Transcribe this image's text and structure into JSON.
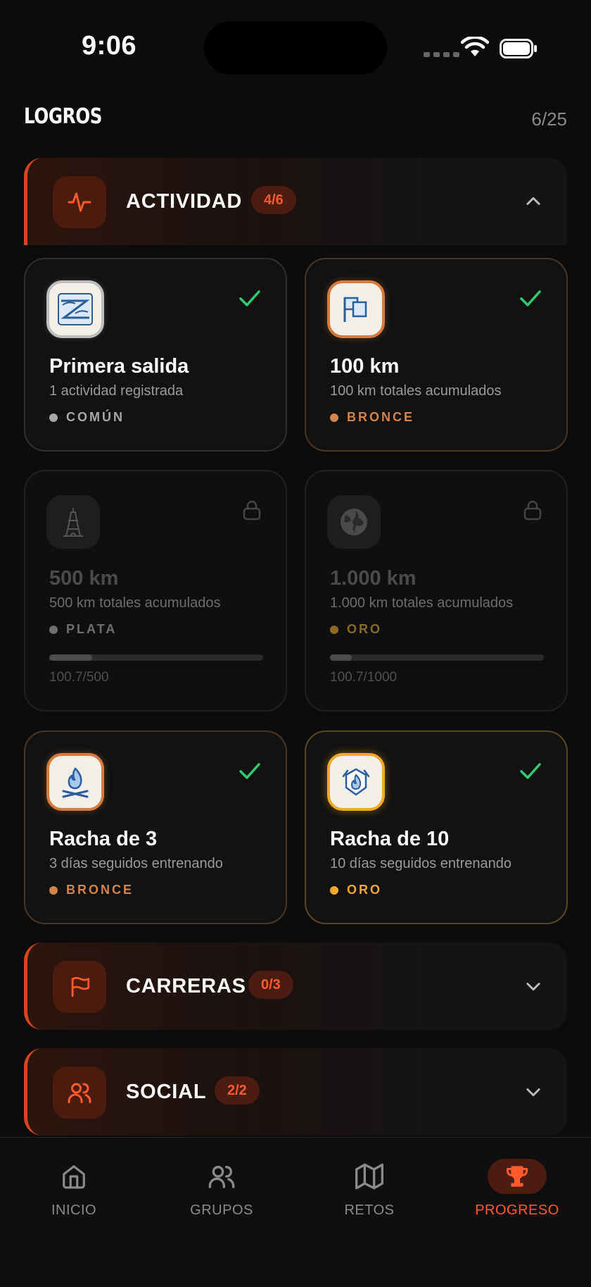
{
  "status_bar": {
    "time": "9:06"
  },
  "header": {
    "title": "LOGROS",
    "count": "6/25"
  },
  "sections": {
    "actividad": {
      "label": "ACTIVIDAD",
      "badge": "4/6",
      "expanded": true
    },
    "carreras": {
      "label": "CARRERAS",
      "badge": "0/3",
      "expanded": false
    },
    "social": {
      "label": "SOCIAL",
      "badge": "2/2",
      "expanded": false
    }
  },
  "achievements": [
    {
      "title": "Primera salida",
      "desc": "1 actividad registrada",
      "tier": "COMÚN",
      "tier_color": "#a8a8a8",
      "unlocked": true,
      "icon": "shoe-icon"
    },
    {
      "title": "100 km",
      "desc": "100 km totales acumulados",
      "tier": "BRONCE",
      "tier_color": "#d4834a",
      "unlocked": true,
      "icon": "flag-icon"
    },
    {
      "title": "500 km",
      "desc": "500 km totales acumulados",
      "tier": "PLATA",
      "tier_color": "#6e6e6e",
      "unlocked": false,
      "icon": "eiffel-tower-icon",
      "progress": "100.7/500",
      "progress_fraction": 0.2014
    },
    {
      "title": "1.000 km",
      "desc": "1.000 km totales acumulados",
      "tier": "ORO",
      "tier_color": "#8a6a24",
      "unlocked": false,
      "icon": "globe-icon",
      "progress": "100.7/1000",
      "progress_fraction": 0.1007
    },
    {
      "title": "Racha de 3",
      "desc": "3 días seguidos entrenando",
      "tier": "BRONCE",
      "tier_color": "#d4834a",
      "unlocked": true,
      "icon": "campfire-icon"
    },
    {
      "title": "Racha de 10",
      "desc": "10 días seguidos entrenando",
      "tier": "ORO",
      "tier_color": "#f2a928",
      "unlocked": true,
      "icon": "flame-shield-icon"
    }
  ],
  "tabs": [
    {
      "label": "INICIO",
      "icon": "home-icon",
      "active": false
    },
    {
      "label": "GRUPOS",
      "icon": "users-icon",
      "active": false
    },
    {
      "label": "RETOS",
      "icon": "map-icon",
      "active": false
    },
    {
      "label": "PROGRESO",
      "icon": "trophy-icon",
      "active": true
    }
  ],
  "colors": {
    "accent": "#ff5a2c",
    "success": "#2ecc71",
    "background": "#0c0c0c"
  }
}
